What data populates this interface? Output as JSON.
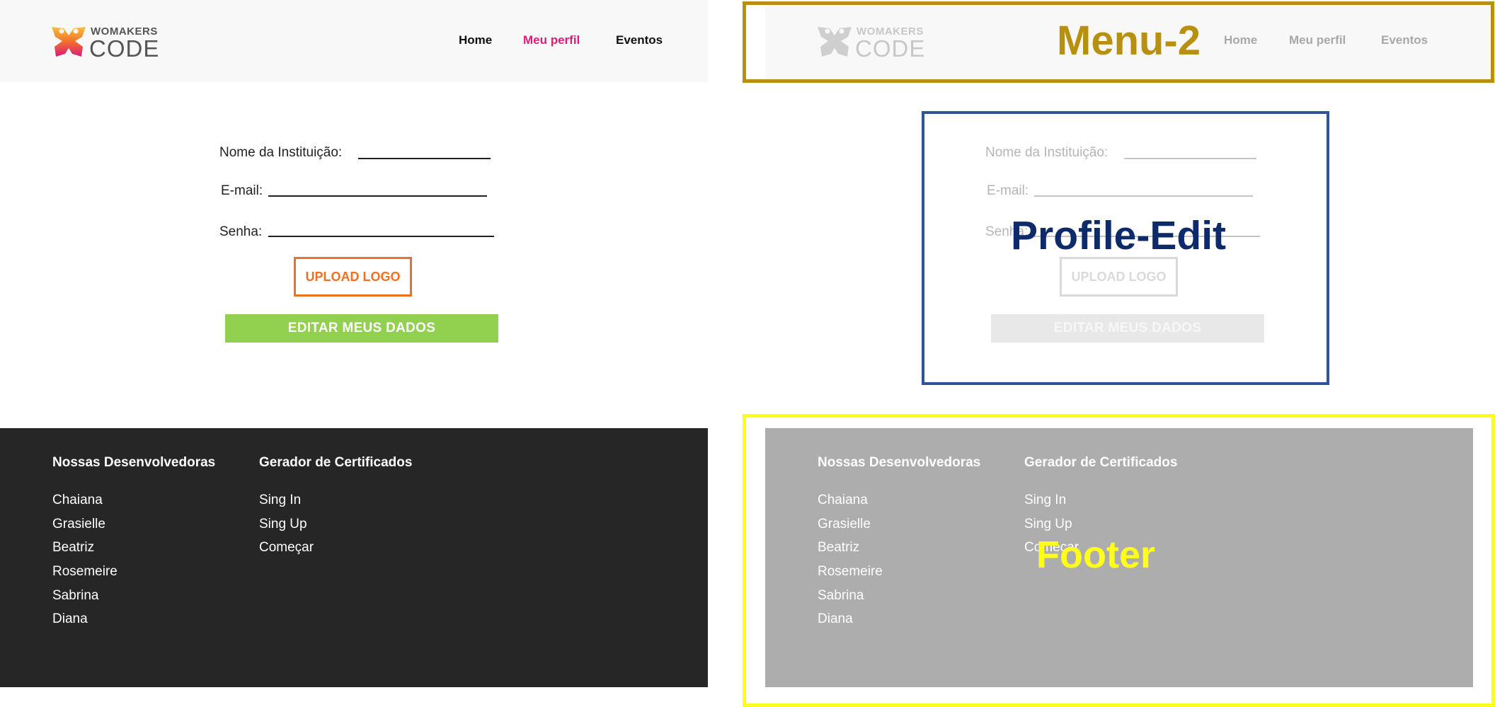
{
  "brand": {
    "line1": "WOMAKERS",
    "line2": "CODE"
  },
  "nav": {
    "items": [
      {
        "label": "Home"
      },
      {
        "label": "Meu perfil",
        "active": true
      },
      {
        "label": "Eventos"
      }
    ]
  },
  "form": {
    "institution_label": "Nome da Instituição:",
    "email_label": "E-mail:",
    "password_label": "Senha:",
    "upload_label": "UPLOAD LOGO",
    "submit_label": "EDITAR MEUS DADOS"
  },
  "footer": {
    "col1_title": "Nossas Desenvolvedoras",
    "col1_items": [
      "Chaiana",
      "Grasielle",
      "Beatriz",
      "Rosemeire",
      "Sabrina",
      "Diana"
    ],
    "col2_title": "Gerador de Certificados",
    "col2_items": [
      "Sing In",
      "Sing Up",
      "Começar"
    ]
  },
  "annotations": {
    "menu": "Menu-2",
    "profile": "Profile-Edit",
    "footer": "Footer"
  },
  "colors": {
    "accent_pink": "#e5197a",
    "upload_orange": "#f07022",
    "submit_green": "#92d050",
    "footer_dark": "#262626",
    "menu_box": "#b8900f",
    "profile_box": "#2f5597",
    "profile_label": "#0d2a6b",
    "footer_box": "#ffff1a"
  }
}
